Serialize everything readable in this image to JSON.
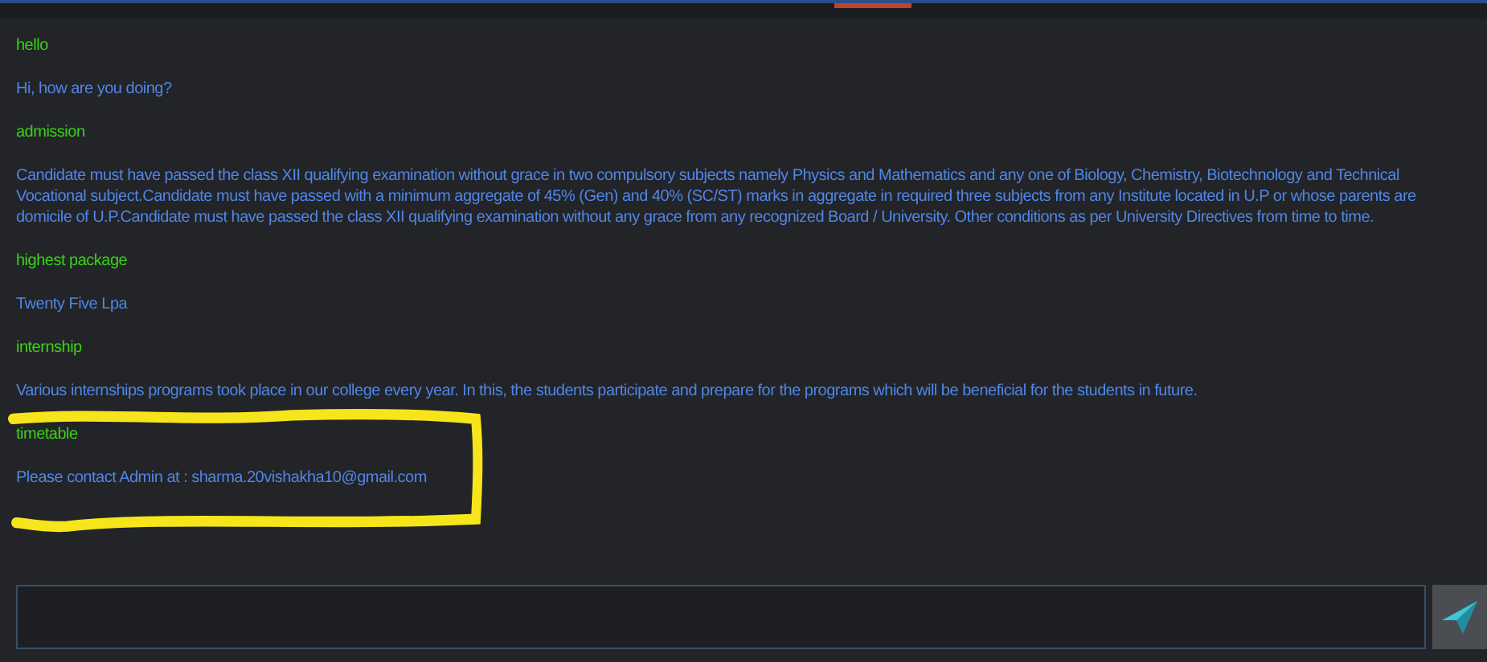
{
  "messages": [
    {
      "kind": "user",
      "text": "hello"
    },
    {
      "kind": "bot",
      "text": "Hi, how are you doing?"
    },
    {
      "kind": "user",
      "text": "admission"
    },
    {
      "kind": "bot",
      "text": "Candidate must have passed the class XII qualifying examination without grace in two compulsory subjects namely Physics and Mathematics and any one of Biology, Chemistry, Biotechnology and Technical Vocational subject.Candidate must have passed with a minimum aggregate of 45% (Gen) and 40% (SC/ST) marks in aggregate in required three subjects from any Institute located in U.P or whose parents are domicile of U.P.Candidate must have passed the class XII qualifying examination without any grace from any recognized Board / University. Other conditions as per University Directives from time to time."
    },
    {
      "kind": "user",
      "text": "highest package"
    },
    {
      "kind": "bot",
      "text": "Twenty Five Lpa"
    },
    {
      "kind": "user",
      "text": "internship"
    },
    {
      "kind": "bot",
      "text": "Various internships programs took place in our college every year. In this, the students participate and prepare for the programs which will be beneficial for the students in future."
    },
    {
      "kind": "user",
      "text": "timetable"
    },
    {
      "kind": "bot",
      "text": "Please contact Admin at : sharma.20vishakha10@gmail.com"
    }
  ]
}
